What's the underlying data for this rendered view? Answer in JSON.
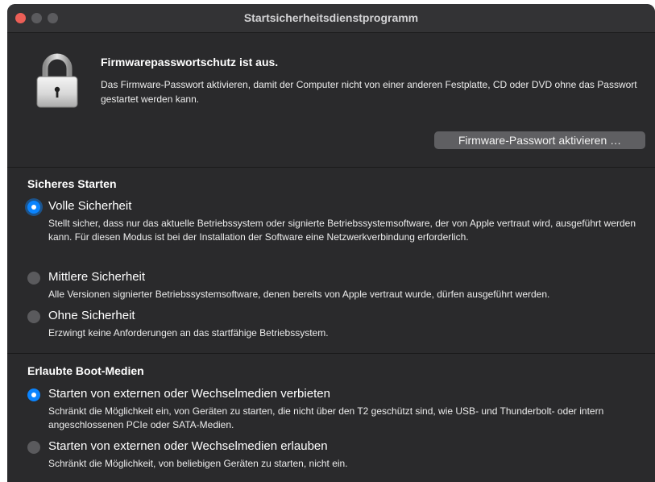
{
  "window": {
    "title": "Startsicherheitsdienstprogramm",
    "colors": {
      "close": "#ec5f57",
      "accent": "#0a84ff",
      "background": "#2a2a2c"
    }
  },
  "firmware": {
    "icon": "lock-icon",
    "heading": "Firmwarepasswortschutz ist aus.",
    "description": "Das Firmware-Passwort aktivieren, damit der Computer nicht von einer anderen Festplatte, CD oder DVD ohne das Passwort gestartet werden kann.",
    "button_label": "Firmware-Passwort aktivieren …"
  },
  "secure_boot": {
    "heading": "Sicheres Starten",
    "options": [
      {
        "label": "Volle Sicherheit",
        "selected": true,
        "description": "Stellt sicher, dass nur das aktuelle Betriebssystem oder signierte Betriebssystemsoftware, der von Apple vertraut wird, ausgeführt werden kann. Für diesen Modus ist bei der Installation der Software eine Netzwerkverbindung erforderlich."
      },
      {
        "label": "Mittlere Sicherheit",
        "selected": false,
        "description": "Alle Versionen signierter Betriebssystemsoftware, denen bereits von Apple vertraut wurde, dürfen ausgeführt werden."
      },
      {
        "label": "Ohne Sicherheit",
        "selected": false,
        "description": "Erzwingt keine Anforderungen an das startfähige Betriebssystem."
      }
    ]
  },
  "boot_media": {
    "heading": "Erlaubte Boot-Medien",
    "options": [
      {
        "label": "Starten von externen oder Wechselmedien verbieten",
        "selected": true,
        "description": "Schränkt die Möglichkeit ein, von Geräten zu starten, die nicht über den T2 geschützt sind, wie USB- und Thunderbolt- oder intern angeschlossenen PCIe oder SATA-Medien."
      },
      {
        "label": "Starten von externen oder Wechselmedien erlauben",
        "selected": false,
        "description": "Schränkt die Möglichkeit, von beliebigen Geräten zu starten, nicht ein."
      }
    ]
  }
}
